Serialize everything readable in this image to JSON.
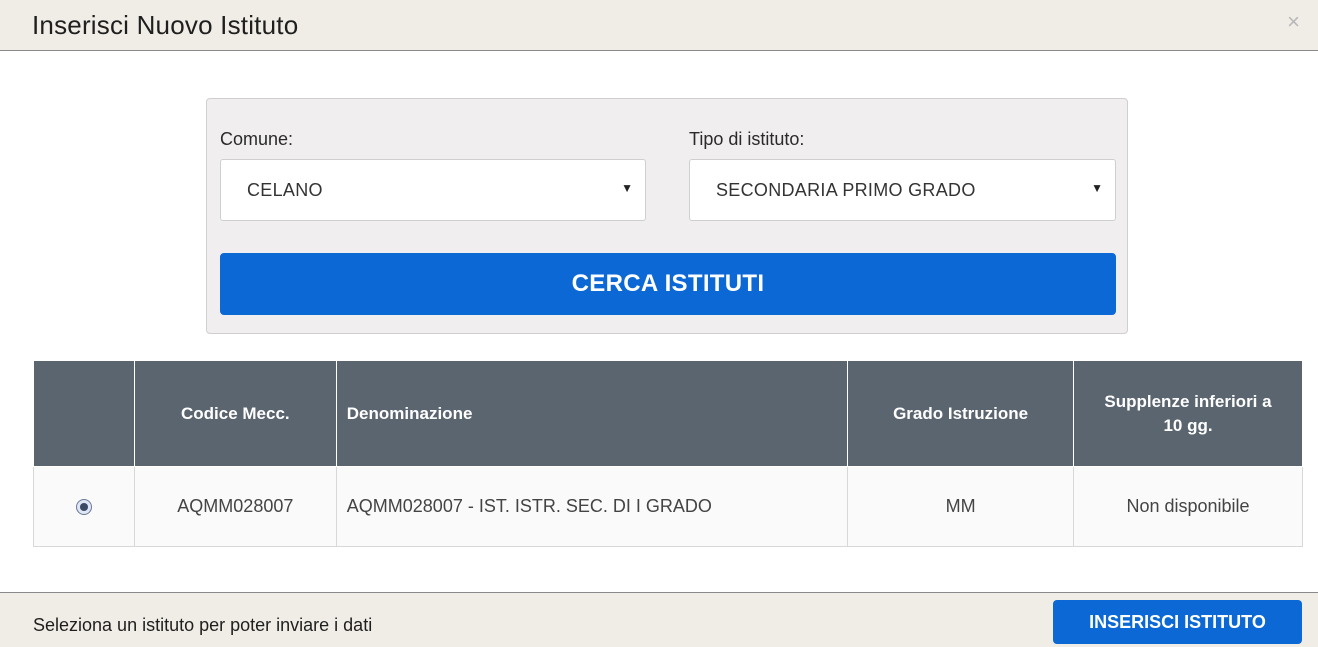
{
  "modal": {
    "title": "Inserisci Nuovo Istituto",
    "close_symbol": "×"
  },
  "search": {
    "comune_label": "Comune:",
    "comune_value": "CELANO",
    "tipo_label": "Tipo di istituto:",
    "tipo_value": "SECONDARIA PRIMO GRADO",
    "caret_symbol": "▼",
    "button_label": "CERCA ISTITUTI"
  },
  "table": {
    "headers": [
      "",
      "Codice Mecc.",
      "Denominazione",
      "Grado Istruzione",
      "Supplenze inferiori a 10 gg."
    ],
    "rows": [
      {
        "selected": true,
        "codice": "AQMM028007",
        "denominazione": "AQMM028007 - IST. ISTR. SEC. DI I GRADO",
        "grado": "MM",
        "supplenze": "Non disponibile"
      }
    ]
  },
  "footer": {
    "message": "Seleziona un istituto per poter inviare i dati",
    "insert_button": "INSERISCI ISTITUTO"
  },
  "colors": {
    "primary_button": "#0b68d4",
    "table_header": "#5b6570",
    "header_bg": "#f0ede6",
    "panel_bg": "#f1eef0"
  },
  "icons": {
    "close": "close-icon",
    "dropdown": "chevron-down-icon",
    "radio": "radio-selected-icon"
  }
}
